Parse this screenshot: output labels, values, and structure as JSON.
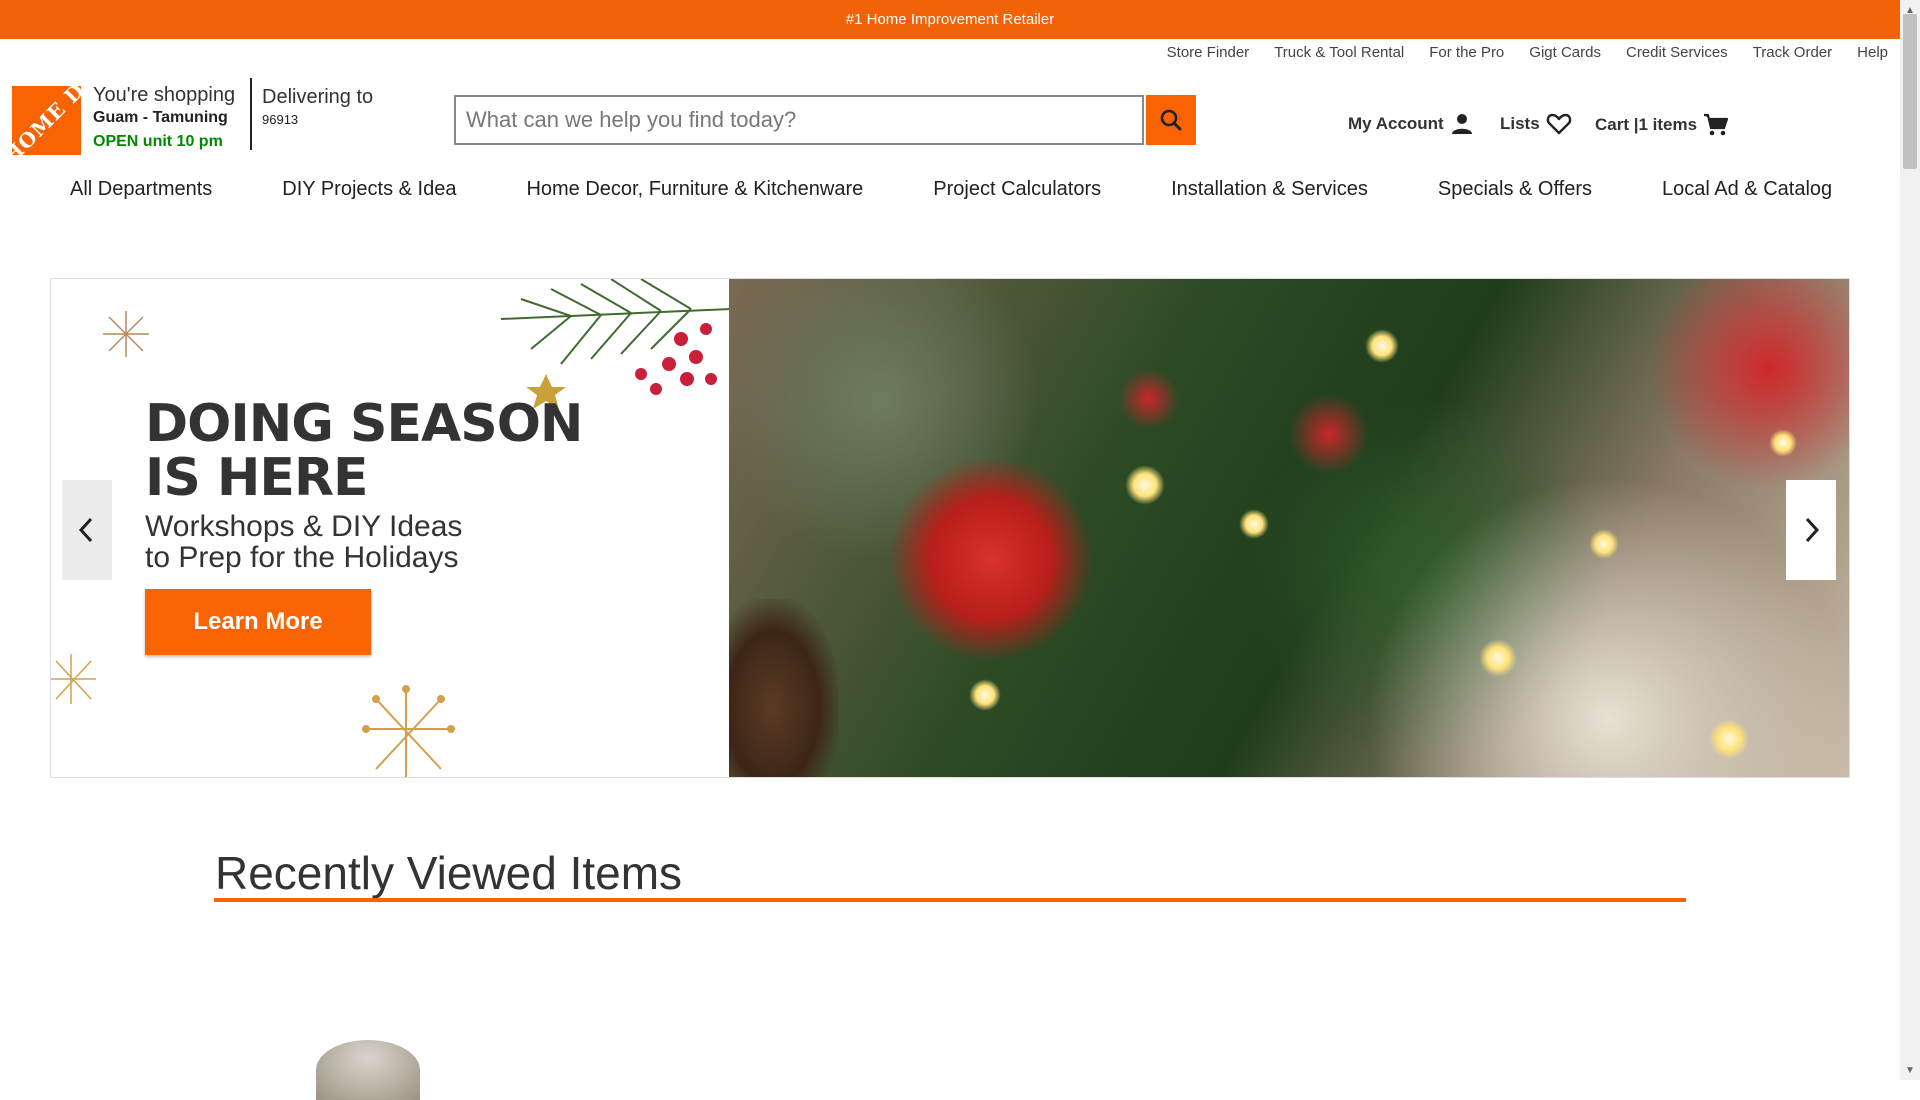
{
  "banner": {
    "text": "#1 Home Improvement Retailer"
  },
  "utility_links": [
    "Store Finder",
    "Truck & Tool Rental",
    "For the Pro",
    "Gigt Cards",
    "Credit Services",
    "Track Order",
    "Help"
  ],
  "logo": {
    "text": "THE HOME DEPOT"
  },
  "store": {
    "label": "You're shopping",
    "name": "Guam - Tamuning",
    "hours": "OPEN unit 10 pm"
  },
  "delivery": {
    "label": "Delivering to",
    "zip": "96913"
  },
  "search": {
    "placeholder": "What can we help you find today?",
    "value": ""
  },
  "account": {
    "my_account": "My Account",
    "lists": "Lists",
    "cart": "Cart |1 items"
  },
  "nav": [
    "All Departments",
    "DIY Projects & Idea",
    "Home Decor, Furniture & Kitchenware",
    "Project Calculators",
    "Installation & Services",
    "Specials & Offers",
    "Local Ad & Catalog"
  ],
  "hero": {
    "title_line1": "DOING SEASON",
    "title_line2": "IS HERE",
    "subtitle_line1": "Workshops & DIY Ideas",
    "subtitle_line2": "to Prep for the Holidays",
    "button": "Learn More"
  },
  "recent": {
    "title": "Recently Viewed Items"
  },
  "colors": {
    "brand_orange": "#f96302",
    "open_green": "#008a00"
  },
  "icons": {
    "search": "search-icon",
    "account": "person-icon",
    "lists": "heart-icon",
    "cart": "cart-icon",
    "prev": "chevron-left-icon",
    "next": "chevron-right-icon"
  }
}
